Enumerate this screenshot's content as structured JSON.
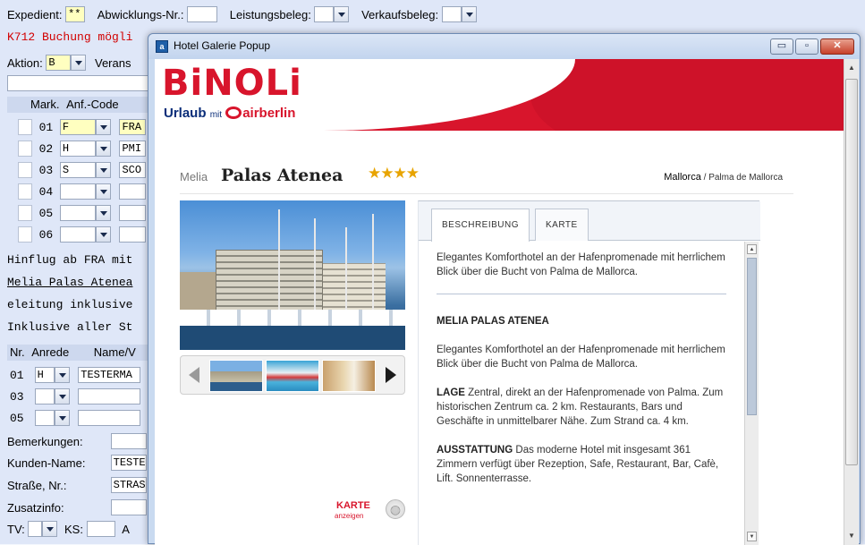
{
  "form": {
    "expedient_label": "Expedient:",
    "expedient_value": "**",
    "abwicklung_label": "Abwicklungs-Nr.:",
    "abwicklung_value": "",
    "leistungsbeleg_label": "Leistungsbeleg:",
    "leistungsbeleg_value": "",
    "verkaufsbeleg_label": "Verkaufsbeleg:",
    "verkaufsbeleg_value": "",
    "status_message": "K712 Buchung mögli",
    "aktion_label": "Aktion:",
    "aktion_value": "B",
    "verans_label": "Verans",
    "mark_header": "Mark.",
    "anfcode_header": "Anf.-Code",
    "rows": [
      {
        "nr": "01",
        "code": "F",
        "value": "FRA"
      },
      {
        "nr": "02",
        "code": "H",
        "value": "PMI"
      },
      {
        "nr": "03",
        "code": "S",
        "value": "SCO"
      },
      {
        "nr": "04",
        "code": "",
        "value": ""
      },
      {
        "nr": "05",
        "code": "",
        "value": ""
      },
      {
        "nr": "06",
        "code": "",
        "value": ""
      }
    ],
    "info_lines": [
      "Hinflug ab FRA mit",
      "Melia Palas Atenea",
      "eleitung inklusive",
      "Inklusive aller St"
    ],
    "nr_header": "Nr.",
    "anrede_header": "Anrede",
    "name_header": "Name/V",
    "persons": [
      {
        "nr": "01",
        "anrede": "H",
        "name": "TESTERMA"
      },
      {
        "nr": "03",
        "anrede": "",
        "name": ""
      },
      {
        "nr": "05",
        "anrede": "",
        "name": ""
      }
    ],
    "bemerkungen_label": "Bemerkungen:",
    "kunden_label": "Kunden-Name:",
    "kunden_value": "TESTE",
    "strasse_label": "Straße, Nr.:",
    "strasse_value": "STRAS",
    "zusatz_label": "Zusatzinfo:",
    "tv_label": "TV:",
    "ks_label": "KS:",
    "a_label": "A"
  },
  "popup": {
    "title": "Hotel Galerie Popup",
    "title_icon": "a",
    "min_btn": "▭",
    "max_btn": "▫",
    "close_btn": "✕",
    "logo_main": "BiNOLi",
    "logo_sub_1": "Urlaub",
    "logo_sub_2": "mit",
    "logo_sub_3": "airberlin",
    "hotel_brand": "Melia",
    "hotel_name": "Palas Atenea",
    "stars": "★★★★",
    "location_region": "Mallorca",
    "location_sep": " / ",
    "location_city": "Palma de Mallorca",
    "tabs": [
      {
        "label": "BESCHREIBUNG",
        "active": true
      },
      {
        "label": "KARTE",
        "active": false
      }
    ],
    "intro": "Elegantes Komforthotel an der Hafenpromenade mit herrlichem Blick über die Bucht von Palma de Mallorca.",
    "section_title": "MELIA PALAS ATENEA",
    "section_intro": "Elegantes Komforthotel an der Hafenpromenade mit herrlichem Blick über die Bucht von Palma de Mallorca.",
    "lage_label": "LAGE",
    "lage_text": "Zentral, direkt an der Hafenpromenade von Palma. Zum historischen Zentrum ca. 2 km. Restaurants, Bars und Geschäfte in unmittelbarer Nähe. Zum Strand ca. 4 km.",
    "ausstattung_label": "AUSSTATTUNG",
    "ausstattung_text": "Das moderne Hotel mit insgesamt 361 Zimmern verfügt über Rezeption, Safe, Restaurant, Bar, Cafè, Lift. Sonnenterrasse.",
    "karte_link": "KARTE",
    "karte_sub": "anzeigen"
  },
  "icons": {
    "globe": "globe-icon",
    "arrow_left": "arrow-left-icon",
    "arrow_right": "arrow-right-icon"
  },
  "colors": {
    "brand_red": "#d8152c",
    "brand_blue": "#0a2d79",
    "star": "#e8a400",
    "form_bg": "#dfe7f8"
  }
}
